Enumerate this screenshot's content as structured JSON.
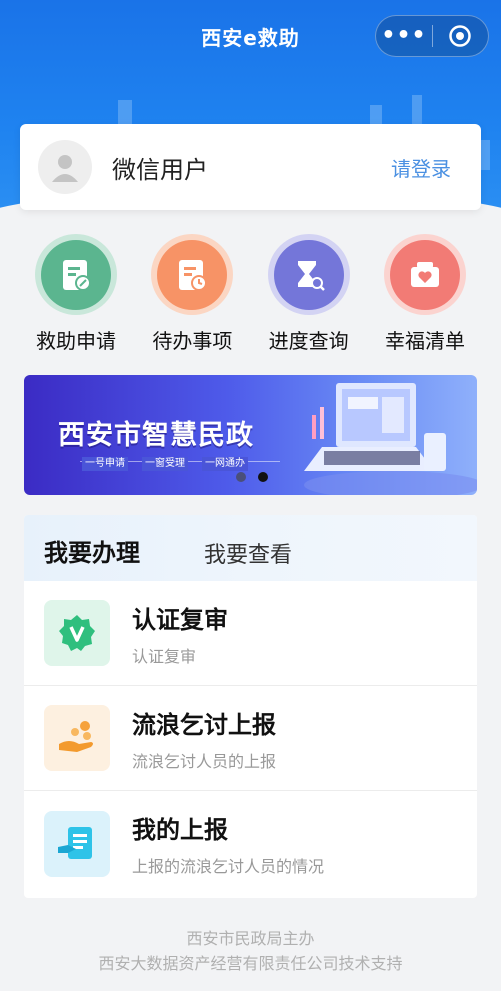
{
  "header": {
    "title": "西安e救助",
    "menu_icon": "more-dots-icon",
    "close_icon": "target-circle-icon"
  },
  "user": {
    "name": "微信用户",
    "login_label": "请登录"
  },
  "quick_entries": [
    {
      "label": "救助申请",
      "icon": "document-pen-icon",
      "color": "#5bb58f"
    },
    {
      "label": "待办事项",
      "icon": "document-clock-icon",
      "color": "#f79366"
    },
    {
      "label": "进度查询",
      "icon": "hourglass-search-icon",
      "color": "#7476d9"
    },
    {
      "label": "幸福清单",
      "icon": "heart-box-icon",
      "color": "#f27b75"
    }
  ],
  "banner": {
    "title": "西安市智慧民政",
    "tags": [
      "一号申请",
      "一窗受理",
      "一网通办"
    ],
    "active_slide": 2,
    "slide_count": 2
  },
  "tabs": {
    "active": "我要办理",
    "inactive": "我要查看"
  },
  "services": [
    {
      "title": "认证复审",
      "subtitle": "认证复审",
      "icon": "verified-badge-icon"
    },
    {
      "title": "流浪乞讨上报",
      "subtitle": "流浪乞讨人员的上报",
      "icon": "hand-coins-icon"
    },
    {
      "title": "我的上报",
      "subtitle": "上报的流浪乞讨人员的情况",
      "icon": "hand-document-icon"
    }
  ],
  "footer": {
    "line1": "西安市民政局主办",
    "line2": "西安大数据资产经营有限责任公司技术支持"
  }
}
